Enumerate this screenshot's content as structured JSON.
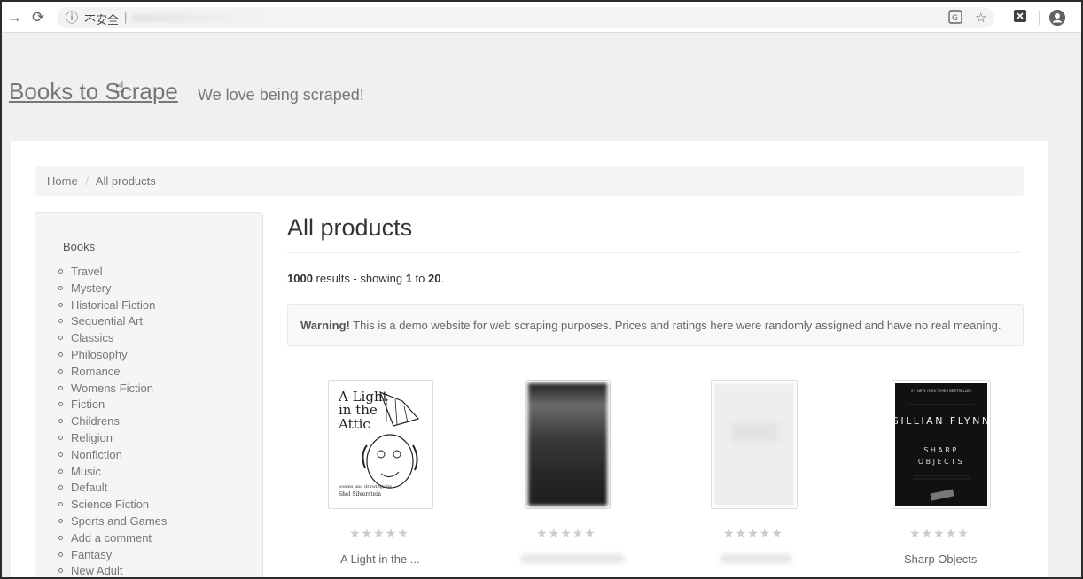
{
  "browser": {
    "security_label": "不安全",
    "url_separator": "|"
  },
  "site": {
    "title": "Books to Scrape",
    "tagline": "We love being scraped!"
  },
  "breadcrumb": {
    "home": "Home",
    "separator": "/",
    "current": "All products"
  },
  "sidebar": {
    "heading": "Books",
    "categories": [
      "Travel",
      "Mystery",
      "Historical Fiction",
      "Sequential Art",
      "Classics",
      "Philosophy",
      "Romance",
      "Womens Fiction",
      "Fiction",
      "Childrens",
      "Religion",
      "Nonfiction",
      "Music",
      "Default",
      "Science Fiction",
      "Sports and Games",
      "Add a comment",
      "Fantasy",
      "New Adult"
    ]
  },
  "main": {
    "title": "All products",
    "results_count": "1000",
    "results_text_mid": " results - showing ",
    "results_from": "1",
    "results_to_word": " to ",
    "results_to": "20",
    "results_end": ".",
    "warning_label": "Warning!",
    "warning_text": " This is a demo website for web scraping purposes. Prices and ratings here were randomly assigned and have no real meaning."
  },
  "products": [
    {
      "title": "A Light in the ...",
      "stars": "★★★★★",
      "cover_title_lines": [
        "A Light",
        "in the",
        "Attic"
      ],
      "cover_author_small": "poems and drawings by",
      "cover_author": "Shel Silverstein"
    },
    {
      "title": "",
      "stars": "★★★★★"
    },
    {
      "title": "",
      "stars": "★★★★★"
    },
    {
      "title": "Sharp Objects",
      "stars": "★★★★★",
      "cover_top_text": "#1 NEW YORK TIMES BESTSELLER",
      "cover_author": "GILLIAN FLYNN",
      "cover_title_lines": [
        "SHARP",
        "OBJECTS"
      ]
    }
  ],
  "colors": {
    "link_gray": "#777777",
    "star_gray": "#cccccc",
    "panel": "#f5f5f5"
  }
}
